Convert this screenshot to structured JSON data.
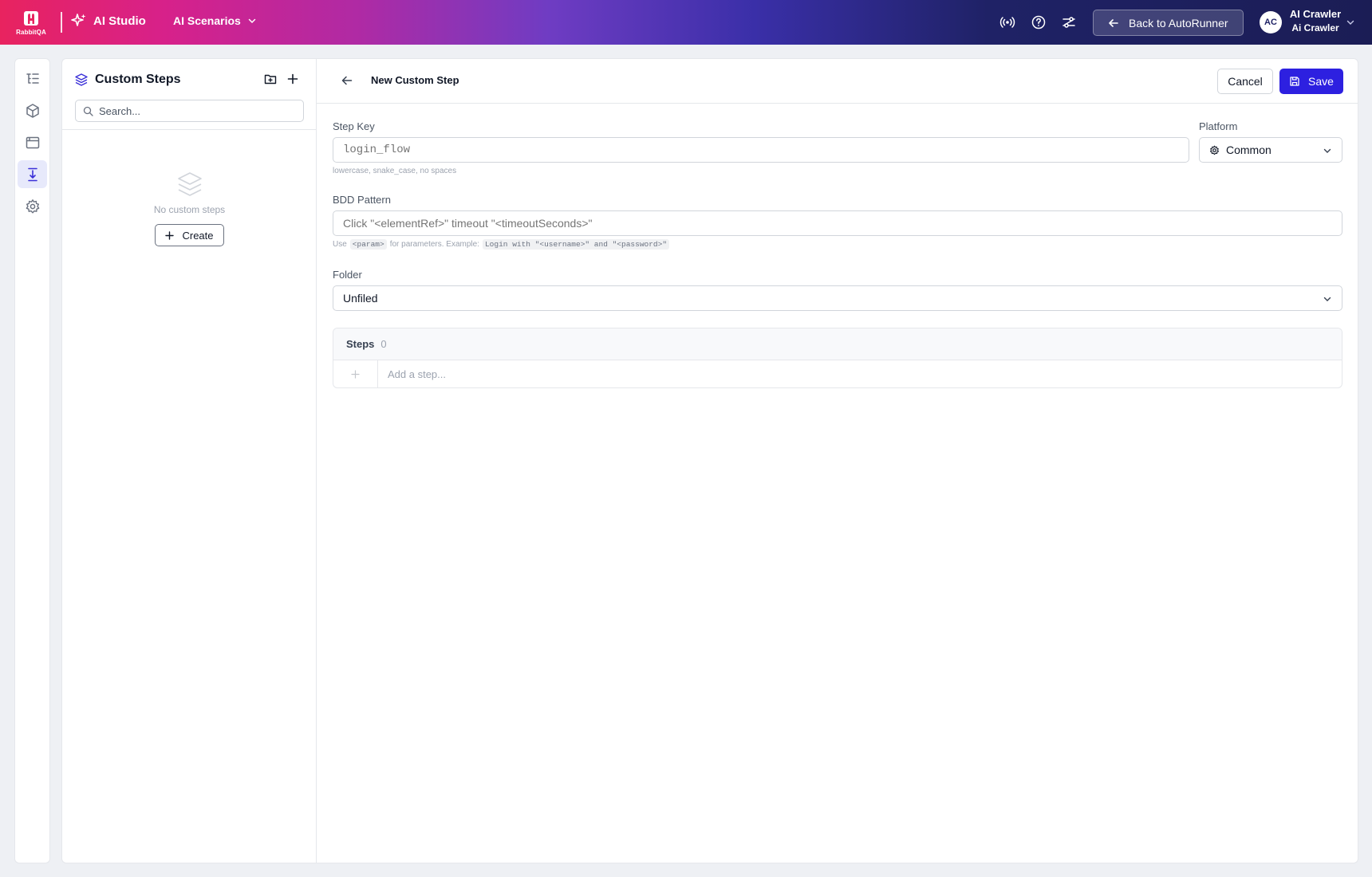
{
  "header": {
    "logo_text": "RabbitQA",
    "app_name": "AI Studio",
    "nav_menu_label": "AI Scenarios",
    "back_button_label": "Back to AutoRunner",
    "user": {
      "initials": "AC",
      "name": "AI Crawler",
      "subtitle": "Ai Crawler"
    },
    "icons": [
      "broadcast-icon",
      "help-icon",
      "settings-sliders-icon"
    ]
  },
  "rail": {
    "items": [
      {
        "icon": "list-tree-icon",
        "active": false
      },
      {
        "icon": "cube-icon",
        "active": false
      },
      {
        "icon": "browser-window-icon",
        "active": false
      },
      {
        "icon": "step-into-icon",
        "active": true
      },
      {
        "icon": "gear-icon",
        "active": false
      }
    ]
  },
  "sidebar": {
    "title": "Custom Steps",
    "search_placeholder": "Search...",
    "empty_text": "No custom steps",
    "create_label": "Create"
  },
  "editor": {
    "title": "New Custom Step",
    "cancel_label": "Cancel",
    "save_label": "Save",
    "step_key": {
      "label": "Step Key",
      "placeholder": "login_flow",
      "hint": "lowercase, snake_case, no spaces"
    },
    "platform": {
      "label": "Platform",
      "value": "Common"
    },
    "bdd_pattern": {
      "label": "BDD Pattern",
      "placeholder": "Click \"<elementRef>\" timeout \"<timeoutSeconds>\"",
      "hint_prefix": "Use",
      "hint_param": "<param>",
      "hint_middle": "for parameters. Example:",
      "hint_example": "Login with \"<username>\" and \"<password>\""
    },
    "folder": {
      "label": "Folder",
      "value": "Unfiled"
    },
    "steps": {
      "title": "Steps",
      "count": "0",
      "add_placeholder": "Add a step..."
    }
  },
  "colors": {
    "primary": "#2d20e0",
    "rail_active_bg": "#e7e9fb",
    "header_gradient_start": "#e8235f",
    "header_gradient_end": "#1b1d55"
  }
}
